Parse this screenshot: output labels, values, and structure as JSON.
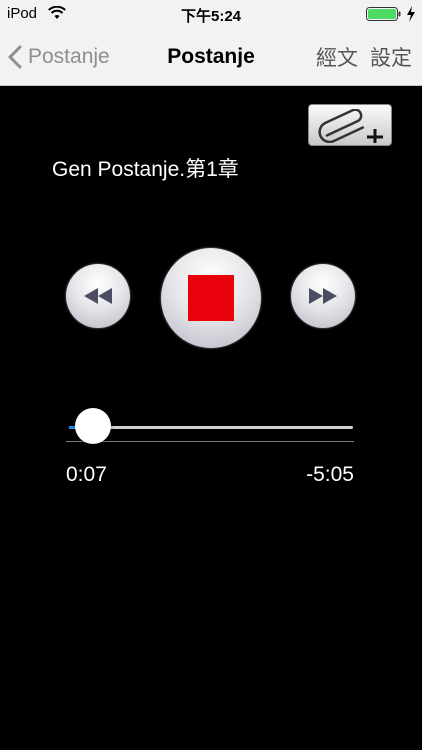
{
  "status_bar": {
    "carrier": "iPod",
    "time": "下午5:24"
  },
  "nav": {
    "back_label": "Postanje",
    "title": "Postanje",
    "scripture_label": "經文",
    "settings_label": "設定"
  },
  "track": {
    "title": "Gen Postanje.第1章"
  },
  "player": {
    "state": "playing",
    "elapsed": "0:07",
    "remaining": "-5:05",
    "progress_fraction": 0.022
  },
  "colors": {
    "stop_red": "#e8000b",
    "progress_blue": "#1a8cff",
    "background": "#000000"
  }
}
